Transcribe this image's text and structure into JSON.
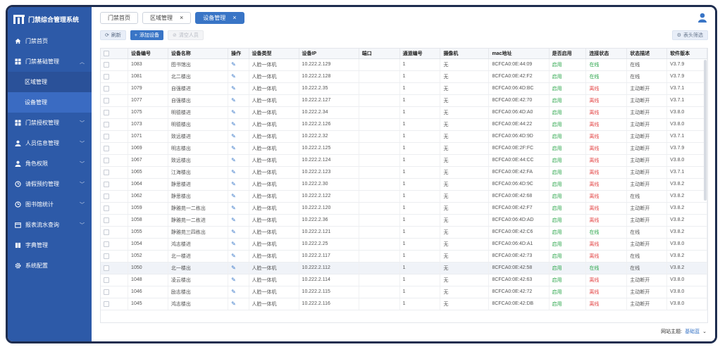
{
  "app": {
    "title": "门禁综合管理系统"
  },
  "sidebar": {
    "items": [
      {
        "label": "门禁首页",
        "icon": "home-icon"
      },
      {
        "label": "门禁基础管理",
        "icon": "grid-icon",
        "expanded": true,
        "children": [
          {
            "label": "区域管理"
          },
          {
            "label": "设备管理",
            "active": true
          }
        ]
      },
      {
        "label": "门禁授权管理",
        "icon": "grid-icon"
      },
      {
        "label": "人员信息管理",
        "icon": "person-icon"
      },
      {
        "label": "角色权限",
        "icon": "person-icon"
      },
      {
        "label": "请假预约管理",
        "icon": "clock-icon"
      },
      {
        "label": "图书馆统计",
        "icon": "clock-icon"
      },
      {
        "label": "报表流水查询",
        "icon": "calendar-icon"
      },
      {
        "label": "字典管理",
        "icon": "book-icon"
      },
      {
        "label": "系统配置",
        "icon": "gear-icon"
      }
    ]
  },
  "tabs": [
    {
      "label": "门禁首页",
      "closable": false,
      "active": false
    },
    {
      "label": "区域管理",
      "closable": true,
      "active": false
    },
    {
      "label": "设备管理",
      "closable": true,
      "active": true
    }
  ],
  "toolbar": {
    "refresh": "刷新",
    "add": "添加设备",
    "clear": "清空人员",
    "filter": "表头筛选"
  },
  "table": {
    "headers": [
      "设备编号",
      "设备名称",
      "操作",
      "设备类型",
      "设备IP",
      "端口",
      "通道编号",
      "摄像机",
      "mac地址",
      "是否启用",
      "连接状态",
      "状态描述",
      "软件版本"
    ],
    "rows": [
      [
        "1083",
        "图书馆出",
        "人脸一体机",
        "10.222.2.129",
        "",
        "1",
        "无",
        "8CFCA0:0E:44:09",
        "启用",
        "在线",
        "在线",
        "V3.7.9"
      ],
      [
        "1081",
        "北二楼出",
        "人脸一体机",
        "10.222.2.128",
        "",
        "1",
        "无",
        "8CFCA0:0E:42:F2",
        "启用",
        "在线",
        "在线",
        "V3.7.9"
      ],
      [
        "1079",
        "自强楼进",
        "人脸一体机",
        "10.222.2.35",
        "",
        "1",
        "无",
        "8CFCA0:06:4D:BC",
        "启用",
        "离线",
        "主动断开",
        "V3.7.1"
      ],
      [
        "1077",
        "自强楼出",
        "人脸一体机",
        "10.222.2.127",
        "",
        "1",
        "无",
        "8CFCA0:0E:42:70",
        "启用",
        "离线",
        "主动断开",
        "V3.7.1"
      ],
      [
        "1075",
        "明德楼进",
        "人脸一体机",
        "10.222.2.34",
        "",
        "1",
        "无",
        "8CFCA0:06:4D:A0",
        "启用",
        "离线",
        "主动断开",
        "V3.8.0"
      ],
      [
        "1073",
        "明德楼出",
        "人脸一体机",
        "10.222.2.126",
        "",
        "1",
        "无",
        "8CFCA0:0E:44:22",
        "启用",
        "离线",
        "主动断开",
        "V3.8.0"
      ],
      [
        "1071",
        "致远楼进",
        "人脸一体机",
        "10.222.2.32",
        "",
        "1",
        "无",
        "8CFCA0:06:4D:9D",
        "启用",
        "离线",
        "主动断开",
        "V3.7.1"
      ],
      [
        "1069",
        "明志楼出",
        "人脸一体机",
        "10.222.2.125",
        "",
        "1",
        "无",
        "8CFCA0:0E:2F:FC",
        "启用",
        "离线",
        "主动断开",
        "V3.7.9"
      ],
      [
        "1067",
        "致远楼出",
        "人脸一体机",
        "10.222.2.124",
        "",
        "1",
        "无",
        "8CFCA0:0E:44:CC",
        "启用",
        "离线",
        "主动断开",
        "V3.8.0"
      ],
      [
        "1065",
        "江海楼出",
        "人脸一体机",
        "10.222.2.123",
        "",
        "1",
        "无",
        "8CFCA0:0E:42:FA",
        "启用",
        "离线",
        "主动断开",
        "V3.7.1"
      ],
      [
        "1064",
        "静思楼进",
        "人脸一体机",
        "10.222.2.30",
        "",
        "1",
        "无",
        "8CFCA0:06:4D:9C",
        "启用",
        "离线",
        "主动断开",
        "V3.8.2"
      ],
      [
        "1062",
        "静思楼出",
        "人脸一体机",
        "10.222.2.122",
        "",
        "1",
        "无",
        "8CFCA0:0E:42:68",
        "启用",
        "离线",
        "在线",
        "V3.8.2"
      ],
      [
        "1059",
        "静雅苑一二栋出",
        "人脸一体机",
        "10.222.2.120",
        "",
        "1",
        "无",
        "8CFCA0:0E:42:F7",
        "启用",
        "离线",
        "主动断开",
        "V3.8.2"
      ],
      [
        "1058",
        "静雅苑一二栋进",
        "人脸一体机",
        "10.222.2.36",
        "",
        "1",
        "无",
        "8CFCA0:06:4D:AD",
        "启用",
        "离线",
        "主动断开",
        "V3.8.2"
      ],
      [
        "1055",
        "静雅苑三四栋出",
        "人脸一体机",
        "10.222.2.121",
        "",
        "1",
        "无",
        "8CFCA0:0E:42:C6",
        "启用",
        "在线",
        "在线",
        "V3.8.2"
      ],
      [
        "1054",
        "鸿志楼进",
        "人脸一体机",
        "10.222.2.25",
        "",
        "1",
        "无",
        "8CFCA0:06:4D:A1",
        "启用",
        "离线",
        "主动断开",
        "V3.8.0"
      ],
      [
        "1052",
        "北一楼进",
        "人脸一体机",
        "10.222.2.117",
        "",
        "1",
        "无",
        "8CFCA0:0E:42:73",
        "启用",
        "离线",
        "在线",
        "V3.8.2"
      ],
      [
        "1050",
        "北一楼出",
        "人脸一体机",
        "10.222.2.112",
        "",
        "1",
        "无",
        "8CFCA0:0E:42:58",
        "启用",
        "在线",
        "在线",
        "V3.8.2"
      ],
      [
        "1048",
        "凌云楼出",
        "人脸一体机",
        "10.222.2.114",
        "",
        "1",
        "无",
        "8CFCA0:0E:42:63",
        "启用",
        "离线",
        "主动断开",
        "V3.8.0"
      ],
      [
        "1046",
        "励志楼出",
        "人脸一体机",
        "10.222.2.115",
        "",
        "1",
        "无",
        "8CFCA0:0E:42:72",
        "启用",
        "离线",
        "主动断开",
        "V3.8.0"
      ],
      [
        "1045",
        "鸿志楼出",
        "人脸一体机",
        "10.222.2.116",
        "",
        "1",
        "无",
        "8CFCA0:0E:42:DB",
        "启用",
        "离线",
        "主动断开",
        "V3.8.0"
      ]
    ],
    "highlight_index": 17
  },
  "footer": {
    "label": "网站主题:",
    "theme": "基础蓝"
  },
  "colors": {
    "sidebar": "#2d5aa8",
    "accent": "#3975c6",
    "online": "#2aa54a",
    "offline": "#e34848"
  }
}
